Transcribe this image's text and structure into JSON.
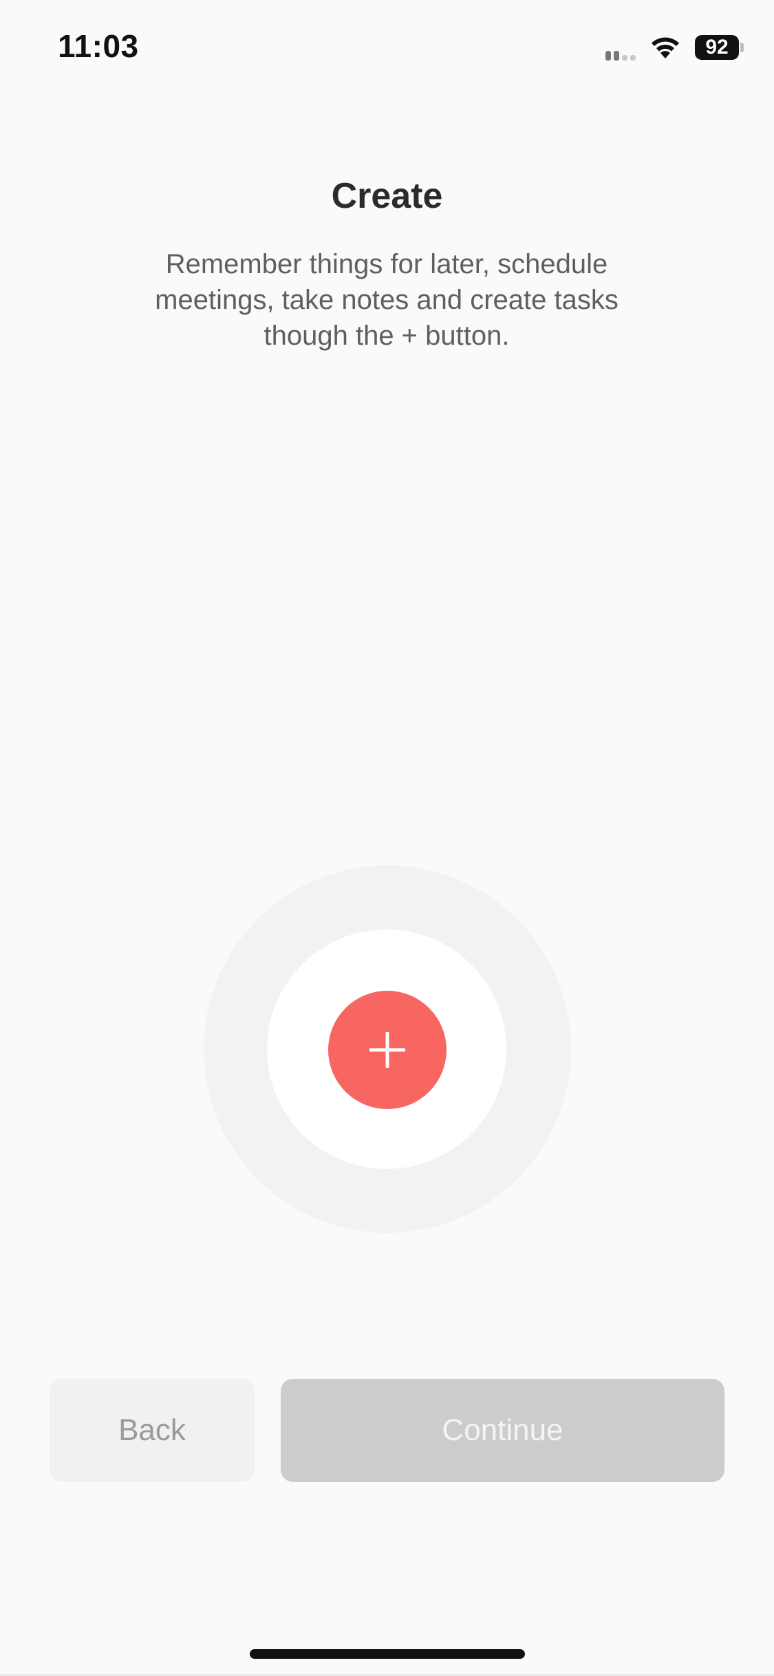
{
  "status_bar": {
    "time": "11:03",
    "battery": "92"
  },
  "screen": {
    "title": "Create",
    "description": "Remember things for later, schedule meetings, take notes and create tasks though the + button."
  },
  "graphic": {
    "icon": "plus-icon",
    "accent_color": "#f76661"
  },
  "footer": {
    "back_label": "Back",
    "continue_label": "Continue"
  }
}
